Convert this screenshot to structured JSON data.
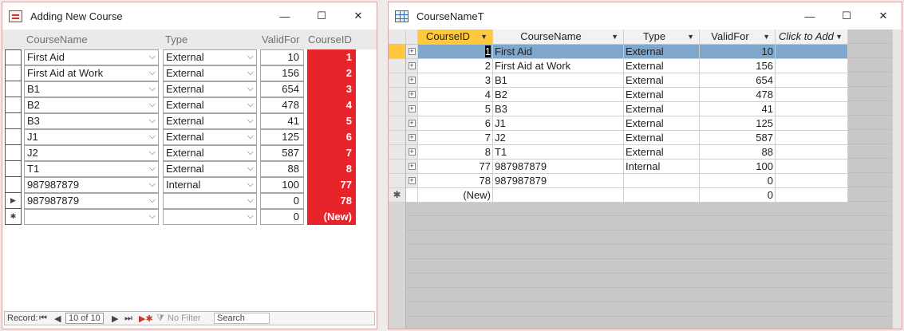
{
  "form_window": {
    "title": "Adding New Course",
    "controls": {
      "minimize": "—",
      "maximize": "☐",
      "close": "✕"
    },
    "headers": {
      "course_name": "CourseName",
      "type": "Type",
      "valid_for": "ValidFor",
      "course_id": "CourseID"
    },
    "rows": [
      {
        "selector": "",
        "course_name": "First Aid",
        "type": "External",
        "valid_for": "10",
        "course_id": "1"
      },
      {
        "selector": "",
        "course_name": "First Aid at Work",
        "type": "External",
        "valid_for": "156",
        "course_id": "2"
      },
      {
        "selector": "",
        "course_name": "B1",
        "type": "External",
        "valid_for": "654",
        "course_id": "3"
      },
      {
        "selector": "",
        "course_name": "B2",
        "type": "External",
        "valid_for": "478",
        "course_id": "4"
      },
      {
        "selector": "",
        "course_name": "B3",
        "type": "External",
        "valid_for": "41",
        "course_id": "5"
      },
      {
        "selector": "",
        "course_name": "J1",
        "type": "External",
        "valid_for": "125",
        "course_id": "6"
      },
      {
        "selector": "",
        "course_name": "J2",
        "type": "External",
        "valid_for": "587",
        "course_id": "7"
      },
      {
        "selector": "",
        "course_name": "T1",
        "type": "External",
        "valid_for": "88",
        "course_id": "8"
      },
      {
        "selector": "",
        "course_name": "987987879",
        "type": "Internal",
        "valid_for": "100",
        "course_id": "77"
      },
      {
        "selector": "▶",
        "course_name": "987987879",
        "type": "",
        "valid_for": "0",
        "course_id": "78"
      },
      {
        "selector": "✱",
        "course_name": "",
        "type": "",
        "valid_for": "0",
        "course_id": "(New)"
      }
    ],
    "navigator": {
      "record_label": "Record:",
      "first": "⏮",
      "prev": "◀",
      "position": "10 of 10",
      "next": "▶",
      "last": "⏭",
      "new": "▶✱",
      "filter": "No Filter",
      "search": "Search"
    },
    "id_color": "#e8242b"
  },
  "table_window": {
    "title": "CourseNameT",
    "controls": {
      "minimize": "—",
      "maximize": "☐",
      "close": "✕"
    },
    "headers": {
      "course_id": "CourseID",
      "course_name": "CourseName",
      "type": "Type",
      "valid_for": "ValidFor",
      "add": "Click to Add"
    },
    "rows": [
      {
        "course_id": "1",
        "course_name": "First Aid",
        "type": "External",
        "valid_for": "10"
      },
      {
        "course_id": "2",
        "course_name": "First Aid at Work",
        "type": "External",
        "valid_for": "156"
      },
      {
        "course_id": "3",
        "course_name": "B1",
        "type": "External",
        "valid_for": "654"
      },
      {
        "course_id": "4",
        "course_name": "B2",
        "type": "External",
        "valid_for": "478"
      },
      {
        "course_id": "5",
        "course_name": "B3",
        "type": "External",
        "valid_for": "41"
      },
      {
        "course_id": "6",
        "course_name": "J1",
        "type": "External",
        "valid_for": "125"
      },
      {
        "course_id": "7",
        "course_name": "J2",
        "type": "External",
        "valid_for": "587"
      },
      {
        "course_id": "8",
        "course_name": "T1",
        "type": "External",
        "valid_for": "88"
      },
      {
        "course_id": "77",
        "course_name": "987987879",
        "type": "Internal",
        "valid_for": "100"
      },
      {
        "course_id": "78",
        "course_name": "987987879",
        "type": "",
        "valid_for": "0"
      }
    ],
    "new_row": {
      "marker": "✱",
      "course_id": "(New)",
      "valid_for": "0"
    },
    "selected_color": "#7fa7cc",
    "header_accent": "#ffc83d"
  }
}
